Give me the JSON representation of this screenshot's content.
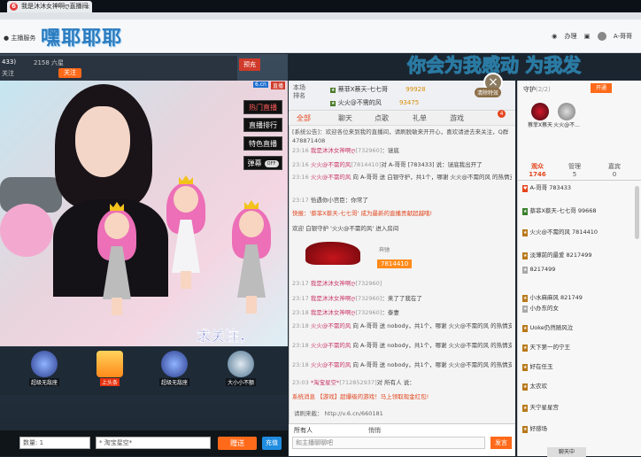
{
  "browser": {
    "tab_title": "我是沐沐女神啊ღ直播间"
  },
  "header": {
    "home_label": "主播服务",
    "logo": "嘿耶耶耶",
    "right_items": [
      "办理",
      "A-哥哥"
    ],
    "marquee": "你会为我感动  为我发"
  },
  "anchor": {
    "id": "433)",
    "fans": "2158 六星",
    "rank": "关注",
    "follow_label": "关注",
    "flag": "预充"
  },
  "video_overlay": {
    "tag_left": "6.cn",
    "tag_right": "直播",
    "buttons": [
      "热门直播",
      "直播排行",
      "特色直播",
      "弹幕"
    ],
    "toggle": "OFF",
    "ticker": "求关注，"
  },
  "gift_row": [
    {
      "label": "超级无敌座"
    },
    {
      "label": "上头条"
    },
    {
      "label": "超级无敌座"
    },
    {
      "label": "大小小不额"
    }
  ],
  "gift_bar": {
    "qty_label": "数量: 1",
    "to_label": "* 淘宝星空*",
    "send_label": "赠送",
    "recharge_label": "充值"
  },
  "rank": {
    "title": "本场\n排名",
    "entries": [
      {
        "name": "蔡菲X蔡天-七七哥",
        "coins": "99928"
      },
      {
        "name": "火火@不需的风",
        "coins": "93475"
      }
    ]
  },
  "chat_tabs": [
    "全部",
    "聊天",
    "点歌",
    "礼单",
    "游戏"
  ],
  "tab_badge": "4",
  "notice": "[系统公告]：欢迎各位来到我的直播间，请刷脱敏来开开心，喜欢请进去来关注，Q群478871408",
  "messages": [
    {
      "time": "23:16",
      "user": "我是沐沐女神啊ღ",
      "id": "[732960]",
      "text": "：谜底"
    },
    {
      "time": "23:16",
      "user": "火火@不需的风",
      "id": "[7814410]",
      "text": "对 A-哥哥 [783433] 说：谜底我出开了"
    },
    {
      "time": "23:16",
      "user": "火火@不需的风",
      "id": "",
      "text": "向 A-哥哥 送 白银守护，共1个，哪谢 火火@不需的风 的热情支持!"
    },
    {
      "time": "23:17",
      "user": "",
      "id": "",
      "text": "恰遇你小宫臣：你常了"
    },
    {
      "time": "",
      "user": "",
      "id": "",
      "text": "快报：'蔡菲X蔡天-七七哥' 成为最新的直播贡献超越哦!"
    },
    {
      "time": "",
      "user": "",
      "id": "",
      "text": "欢迎 白银守护 '火火@不需的风' 进入房间"
    },
    {
      "time": "23:17",
      "user": "我是沐沐女神啊ღ",
      "id": "[732960]",
      "text": ""
    },
    {
      "time": "23:17",
      "user": "我是沐沐女神啊ღ",
      "id": "[732960]",
      "text": "：来了了我在了"
    },
    {
      "time": "23:18",
      "user": "我是沐沐女神啊ღ",
      "id": "[732960]",
      "text": "：泰妻"
    },
    {
      "time": "23:18",
      "user": "火火@不需的风",
      "id": "",
      "text": "向 A-哥哥 送 nobody，共1个，哪谢 火火@不需的风 的热情支持!"
    },
    {
      "time": "23:18",
      "user": "火火@不需的风",
      "id": "",
      "text": "向 A-哥哥 送 nobody，共1个，哪谢 火火@不需的风 的热情支持!"
    },
    {
      "time": "23:18",
      "user": "火火@不需的风",
      "id": "",
      "text": "向 A-哥哥 送 nobody，共1个，哪谢 火火@不需的风 的热情支持!"
    },
    {
      "time": "23:03",
      "user": "*淘宝星空*",
      "id": "[712852937]",
      "text": "对 所有人 说："
    },
    {
      "time": "",
      "user": "",
      "id": "",
      "text": "系统消息 【游戏】超爆级的游戏！马上领取现金红包!"
    }
  ],
  "car": {
    "title": "奔驰",
    "owner": "7814410"
  },
  "link": "请刷来截：  http://v.6.cn/660181",
  "chat_footer": {
    "target": "所有人",
    "whisper": "悄悄",
    "placeholder": "和主播聊聊吧",
    "send_label": "发言"
  },
  "fx": {
    "close": "×",
    "label": "清除特效"
  },
  "right": {
    "guard_title": "守护",
    "guard_count": "(2/2)",
    "open_label": "开通",
    "guards": [
      "蔡菲X蔡天",
      "火火@不..."
    ],
    "viewer_tabs": [
      {
        "label": "观众",
        "count": "1746"
      },
      {
        "label": "管理",
        "count": "5"
      },
      {
        "label": "嘉宾",
        "count": "0"
      }
    ],
    "viewers": [
      "A-哥哥  783433",
      "蔡菲X蔡天-七七哥  99668",
      "火火@不需的风  7814410",
      "淡薄前的最爱  8217499",
      "8217499",
      "小水麻麻风  821749",
      "小办东的女",
      "Uoke仍然随风泣",
      "天下第一的宁王",
      "好在任玉",
      "太农欢",
      "天宁星星宫",
      "好感场"
    ],
    "follow_btn": "聊天中"
  }
}
